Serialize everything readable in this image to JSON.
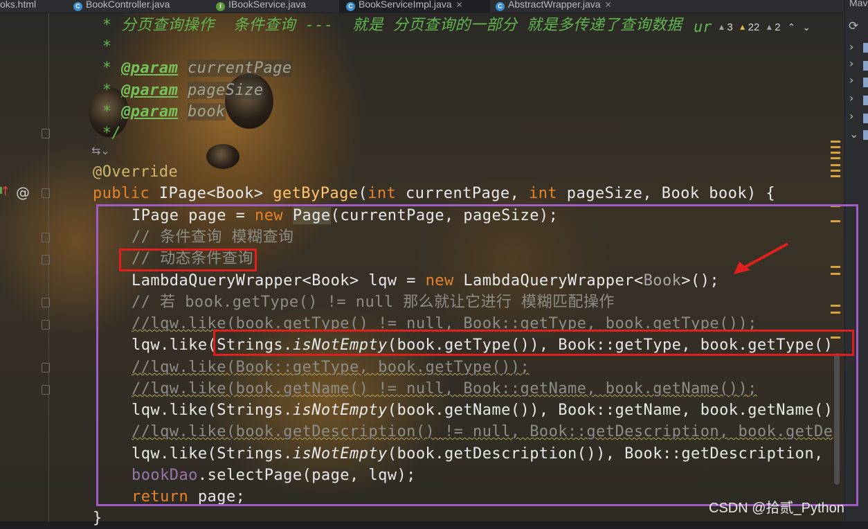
{
  "tabs": [
    {
      "label": "oks.html",
      "icon": ""
    },
    {
      "label": "BookController.java",
      "icon": "C"
    },
    {
      "label": "IBookService.java",
      "icon": "I"
    },
    {
      "label": "BookServiceImpl.java",
      "icon": "C"
    },
    {
      "label": "AbstractWrapper.java",
      "icon": "C"
    }
  ],
  "right_panel": {
    "title": "Mav"
  },
  "inspections": {
    "warnings": "3",
    "weak_warnings": "22",
    "typos": "2",
    "ur_text": "ur"
  },
  "code": {
    "l1_doc": " * 分页查询操作  条件查询 ---  就是 分页查询的一部分 就是多传递了查询数据",
    "l2_doc": " *",
    "l3_star": " * ",
    "l3_tag": "@param",
    "l3_name": "currentPage",
    "l4_star": " * ",
    "l4_tag": "@param",
    "l4_name": "pageSize",
    "l5_star": " * ",
    "l5_tag": "@param",
    "l5_name": "book",
    "l6_doc": " */",
    "l7_ann": "@Override",
    "l8_kw": "public",
    "l8_type": " IPage<Book> ",
    "l8_fn": "getByPage",
    "l8_p1": "(",
    "l8_int1": "int",
    "l8_p2": " currentPage, ",
    "l8_int2": "int",
    "l8_p3": " pageSize, Book book) {",
    "l9_a": "IPage page = ",
    "l9_new": "new",
    "l9_page": "Page",
    "l9_b": "(currentPage, pageSize);",
    "l10_cm": "// 条件查询 模糊查询",
    "l11_cm": "// 动态条件查询",
    "l12_a": "LambdaQueryWrapper<Book> lqw = ",
    "l12_new": "new",
    "l12_b": " LambdaQueryWrapper<",
    "l12_book": "Book",
    "l12_c": ">();",
    "l13_cm": "// 若 book.getType() != null 那么就让它进行 模糊匹配操作",
    "l14_cm": "//lqw.like(book.getType() != null, Book::getType, book.getType());",
    "l15_a": "lqw.like(Strings.",
    "l15_i": "isNotEmpty",
    "l15_b": "(book.getType()), Book::getType, book.getType()",
    "l16_cm": "//lqw.like(Book::getType, book.getType());",
    "l17_cm": "//lqw.like(book.getName() != null, Book::getName, book.getName());",
    "l18_a": "lqw.like(Strings.",
    "l18_i": "isNotEmpty",
    "l18_b": "(book.getName()), Book::getName, book.getName()",
    "l19_cm": "//lqw.like(book.getDescription() != null, Book::getDescription, book.getDe",
    "l20_a": "lqw.like(Strings.",
    "l20_i": "isNotEmpty",
    "l20_b": "(book.getDescription()), Book::getDescription, ",
    "l21_field": "bookDao",
    "l21_b": ".selectPage(page, lqw);",
    "l22_kw": "return",
    "l22_b": " page;",
    "l23": "}"
  },
  "watermark": "CSDN @拾贰_Python",
  "colors": {
    "annotation_purple": "#a25cc8",
    "annotation_red": "#e0201c",
    "keyword": "#e6842a",
    "doc_comment": "#62b54f"
  }
}
